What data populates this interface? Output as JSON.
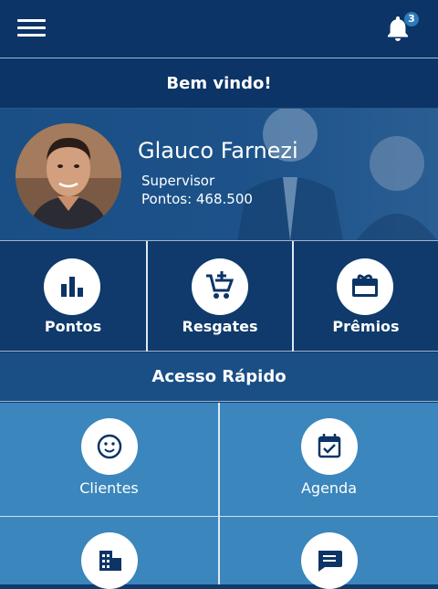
{
  "header": {
    "menu_icon": "hamburger-menu-icon",
    "bell_icon": "bell-icon",
    "notification_count": "3"
  },
  "welcome": {
    "text": "Bem vindo!"
  },
  "profile": {
    "name": "Glauco Farnezi",
    "role": "Supervisor",
    "points": "Pontos: 468.500"
  },
  "actions": [
    {
      "label": "Pontos",
      "icon": "bar-chart-icon"
    },
    {
      "label": "Resgates",
      "icon": "add-to-cart-icon"
    },
    {
      "label": "Prêmios",
      "icon": "gift-card-icon"
    }
  ],
  "quick_access": {
    "title": "Acesso Rápido",
    "items": [
      {
        "label": "Clientes",
        "icon": "smiley-icon"
      },
      {
        "label": "Agenda",
        "icon": "calendar-check-icon"
      },
      {
        "label": "",
        "icon": "building-icon"
      },
      {
        "label": "",
        "icon": "chat-icon"
      }
    ]
  },
  "colors": {
    "primary": "#0c3466",
    "accent": "#3a86bd",
    "profile_band": "#1c5289"
  }
}
